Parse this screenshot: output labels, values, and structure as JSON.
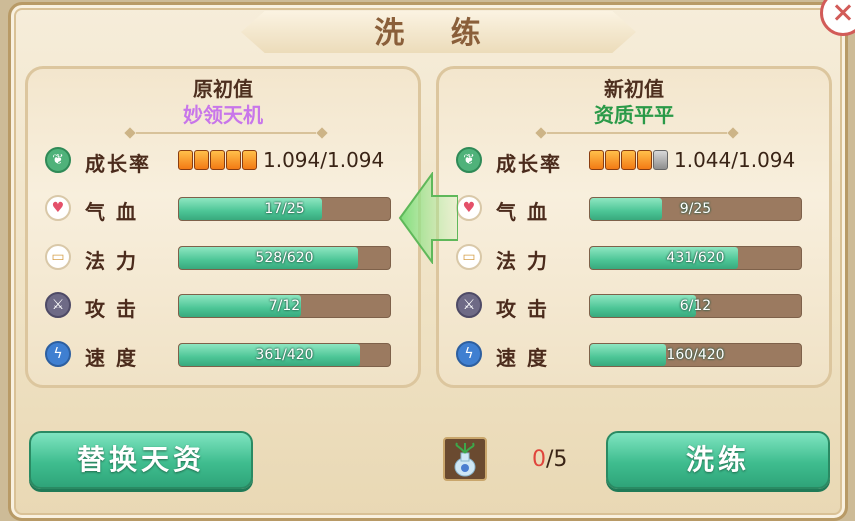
{
  "title": "洗 练",
  "original": {
    "heading": "原初值",
    "quality": "妙领天机",
    "quality_color": "#c876ea",
    "growth": {
      "label": "成长率",
      "value": "1.094/1.094",
      "pips_filled": 5,
      "pips_total": 5
    },
    "stats": [
      {
        "icon": "heart-icon",
        "label": "气 血",
        "text": "17/25",
        "fill": 0.68
      },
      {
        "icon": "scroll-icon",
        "label": "法 力",
        "text": "528/620",
        "fill": 0.85
      },
      {
        "icon": "sword-icon",
        "label": "攻 击",
        "text": "7/12",
        "fill": 0.58
      },
      {
        "icon": "lightning-icon",
        "label": "速 度",
        "text": "361/420",
        "fill": 0.86
      }
    ]
  },
  "new": {
    "heading": "新初值",
    "quality": "资质平平",
    "quality_color": "#2a9a48",
    "growth": {
      "label": "成长率",
      "value": "1.044/1.094",
      "pips_filled": 4,
      "pips_total": 5
    },
    "stats": [
      {
        "icon": "heart-icon",
        "label": "气 血",
        "text": "9/25",
        "fill": 0.34
      },
      {
        "icon": "scroll-icon",
        "label": "法 力",
        "text": "431/620",
        "fill": 0.7
      },
      {
        "icon": "sword-icon",
        "label": "攻 击",
        "text": "6/12",
        "fill": 0.5
      },
      {
        "icon": "lightning-icon",
        "label": "速 度",
        "text": "160/420",
        "fill": 0.36
      }
    ]
  },
  "buttons": {
    "replace": "替换天资",
    "wash": "洗练"
  },
  "item": {
    "icon": "potion-vase-icon",
    "have": "0",
    "need": "/5"
  }
}
